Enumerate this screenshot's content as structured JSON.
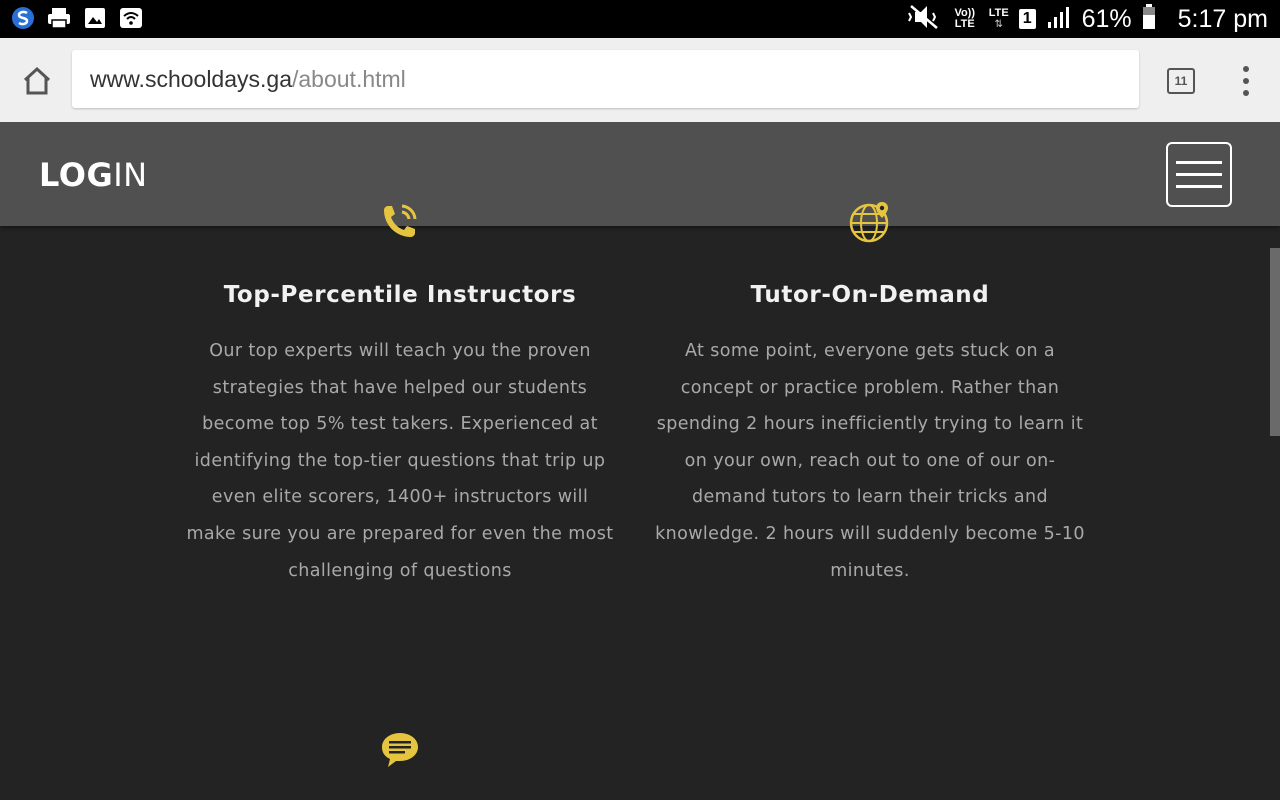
{
  "status_bar": {
    "left_icons": [
      "s-app-icon",
      "printer-icon",
      "image-icon",
      "wifi-hotspot-icon"
    ],
    "volte_label": "Vo)) LTE",
    "lte_label": "LTE",
    "sim_slot": "1",
    "battery": "61%",
    "time": "5:17 pm"
  },
  "browser": {
    "url_host": "www.schooldays.ga",
    "url_path": "/about.html",
    "tab_count": "11"
  },
  "site": {
    "logo_bold": "LOG",
    "logo_light": "IN",
    "accent_color": "#e5c53f"
  },
  "features": [
    {
      "icon": "phone-call-icon",
      "title": "Top-Percentile Instructors",
      "body": "Our top experts will teach you the proven strategies that have helped our students become top 5% test takers. Experienced at identifying the top-tier questions that trip up even elite scorers, 1400+ instructors will make sure you are prepared for even the most challenging of questions"
    },
    {
      "icon": "globe-location-icon",
      "title": "Tutor-On-Demand",
      "body": "At some point, everyone gets stuck on a concept or practice problem. Rather than spending 2 hours inefficiently trying to learn it on your own, reach out to one of our on-demand tutors to learn their tricks and knowledge. 2 hours will suddenly become 5-10 minutes."
    }
  ],
  "next_feature_icon": "chat-bubble-icon"
}
